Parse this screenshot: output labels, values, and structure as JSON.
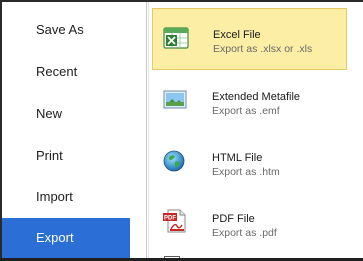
{
  "sidebar": {
    "items": [
      {
        "label": "Save As"
      },
      {
        "label": "Recent"
      },
      {
        "label": "New"
      },
      {
        "label": "Print"
      },
      {
        "label": "Import"
      },
      {
        "label": "Export",
        "active": true
      }
    ]
  },
  "export_options": [
    {
      "title": "Excel File",
      "subtitle": "Export as .xlsx or .xls",
      "icon": "excel-icon",
      "selected": true
    },
    {
      "title": "Extended Metafile",
      "subtitle": "Export as .emf",
      "icon": "image-icon"
    },
    {
      "title": "HTML File",
      "subtitle": "Export as .htm",
      "icon": "globe-icon"
    },
    {
      "title": "PDF File",
      "subtitle": "Export as .pdf",
      "icon": "pdf-icon",
      "icon_text": "PDF"
    }
  ],
  "colors": {
    "accent": "#2b6fd6",
    "selected_bg": "#fdeea6",
    "selected_border": "#e8c866"
  }
}
